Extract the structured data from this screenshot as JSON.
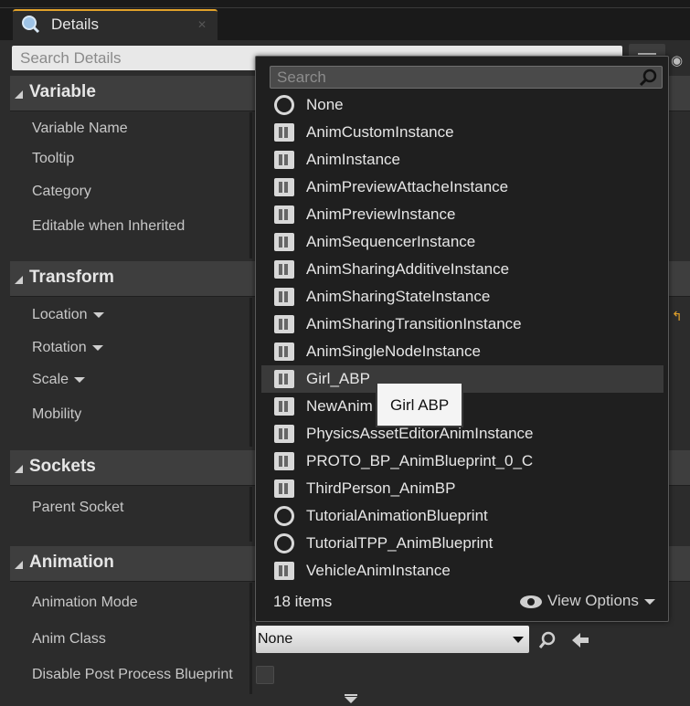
{
  "tab": {
    "title": "Details",
    "icon": "magnifier-icon"
  },
  "details_search": {
    "placeholder": "Search Details"
  },
  "sections": [
    {
      "title": "Variable",
      "props": [
        "Variable Name",
        "Tooltip",
        "Category",
        "Editable when Inherited"
      ]
    },
    {
      "title": "Transform",
      "props": [
        "Location",
        "Rotation",
        "Scale",
        "Mobility"
      ]
    },
    {
      "title": "Sockets",
      "props": [
        "Parent Socket"
      ]
    },
    {
      "title": "Animation",
      "props": [
        "Animation Mode",
        "Anim Class",
        "Disable Post Process Blueprint"
      ]
    }
  ],
  "anim_class": {
    "value": "None"
  },
  "dropdown": {
    "search_placeholder": "Search",
    "items": [
      {
        "label": "None",
        "icon": "none-ring-icon"
      },
      {
        "label": "AnimCustomInstance",
        "icon": "anim-blueprint-icon"
      },
      {
        "label": "AnimInstance",
        "icon": "anim-blueprint-icon"
      },
      {
        "label": "AnimPreviewAttacheInstance",
        "icon": "anim-blueprint-icon"
      },
      {
        "label": "AnimPreviewInstance",
        "icon": "anim-blueprint-icon"
      },
      {
        "label": "AnimSequencerInstance",
        "icon": "anim-blueprint-icon"
      },
      {
        "label": "AnimSharingAdditiveInstance",
        "icon": "anim-blueprint-icon"
      },
      {
        "label": "AnimSharingStateInstance",
        "icon": "anim-blueprint-icon"
      },
      {
        "label": "AnimSharingTransitionInstance",
        "icon": "anim-blueprint-icon"
      },
      {
        "label": "AnimSingleNodeInstance",
        "icon": "anim-blueprint-icon"
      },
      {
        "label": "Girl_ABP",
        "icon": "anim-blueprint-icon",
        "selected": true
      },
      {
        "label": "NewAnim",
        "icon": "anim-blueprint-icon"
      },
      {
        "label": "PhysicsAssetEditorAnimInstance",
        "icon": "anim-blueprint-icon"
      },
      {
        "label": "PROTO_BP_AnimBlueprint_0_C",
        "icon": "anim-blueprint-icon"
      },
      {
        "label": "ThirdPerson_AnimBP",
        "icon": "anim-blueprint-icon"
      },
      {
        "label": "TutorialAnimationBlueprint",
        "icon": "none-ring-icon"
      },
      {
        "label": "TutorialTPP_AnimBlueprint",
        "icon": "none-ring-icon"
      },
      {
        "label": "VehicleAnimInstance",
        "icon": "anim-blueprint-icon"
      }
    ],
    "count_label": "18 items",
    "view_options_label": "View Options"
  },
  "tooltip": {
    "text": "Girl ABP"
  }
}
